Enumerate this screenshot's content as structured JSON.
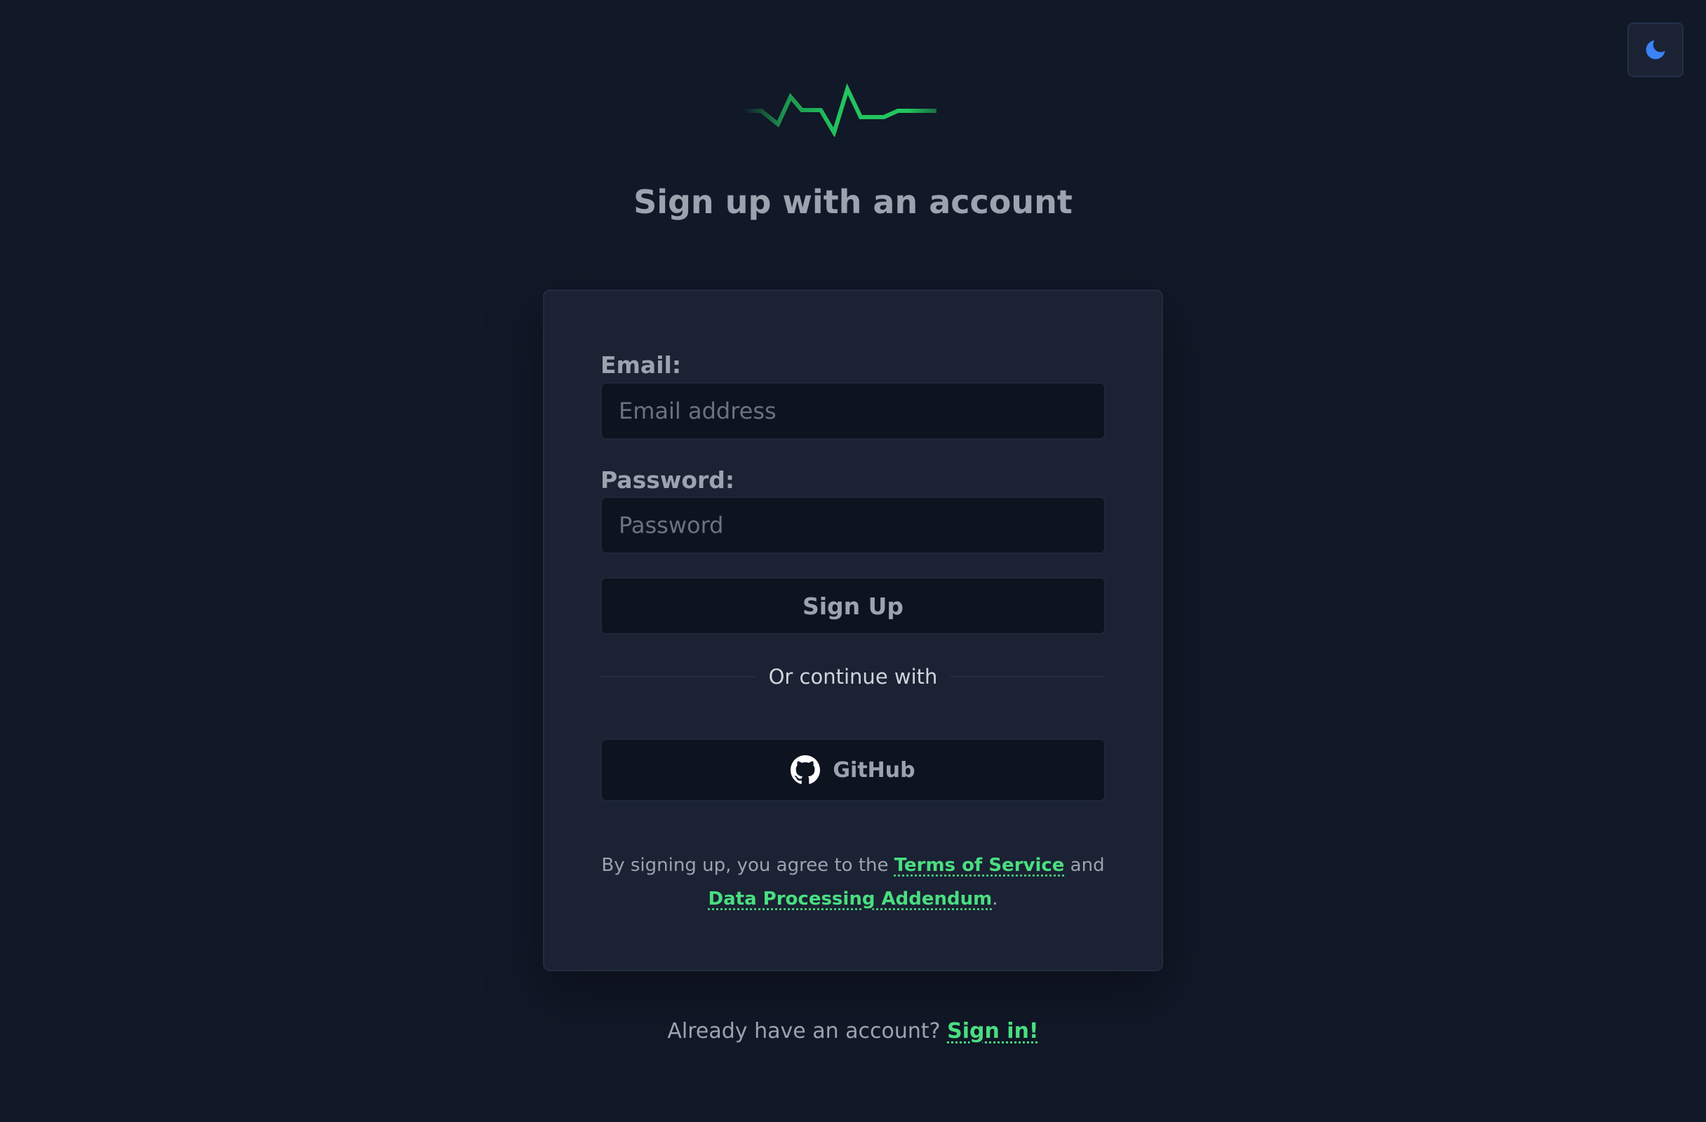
{
  "theme_toggle": {
    "icon": "moon-icon",
    "color": "#3b82f6"
  },
  "logo": {
    "icon": "heartbeat-logo-icon",
    "color": "#22c55e"
  },
  "title": "Sign up with an account",
  "form": {
    "email_label": "Email:",
    "email_placeholder": "Email address",
    "email_value": "",
    "password_label": "Password:",
    "password_placeholder": "Password",
    "password_value": "",
    "submit_label": "Sign Up"
  },
  "divider_text": "Or continue with",
  "github": {
    "icon": "github-icon",
    "label": "GitHub"
  },
  "terms": {
    "prefix": "By signing up, you agree to the ",
    "tos_link": "Terms of Service",
    "and": " and",
    "dpa_link": "Data Processing Addendum",
    "suffix": "."
  },
  "signin": {
    "prompt": "Already have an account? ",
    "link": "Sign in!"
  },
  "colors": {
    "background": "#111827",
    "card": "#1a2234",
    "accent": "#4ade80",
    "muted_text": "#9ca3af"
  }
}
